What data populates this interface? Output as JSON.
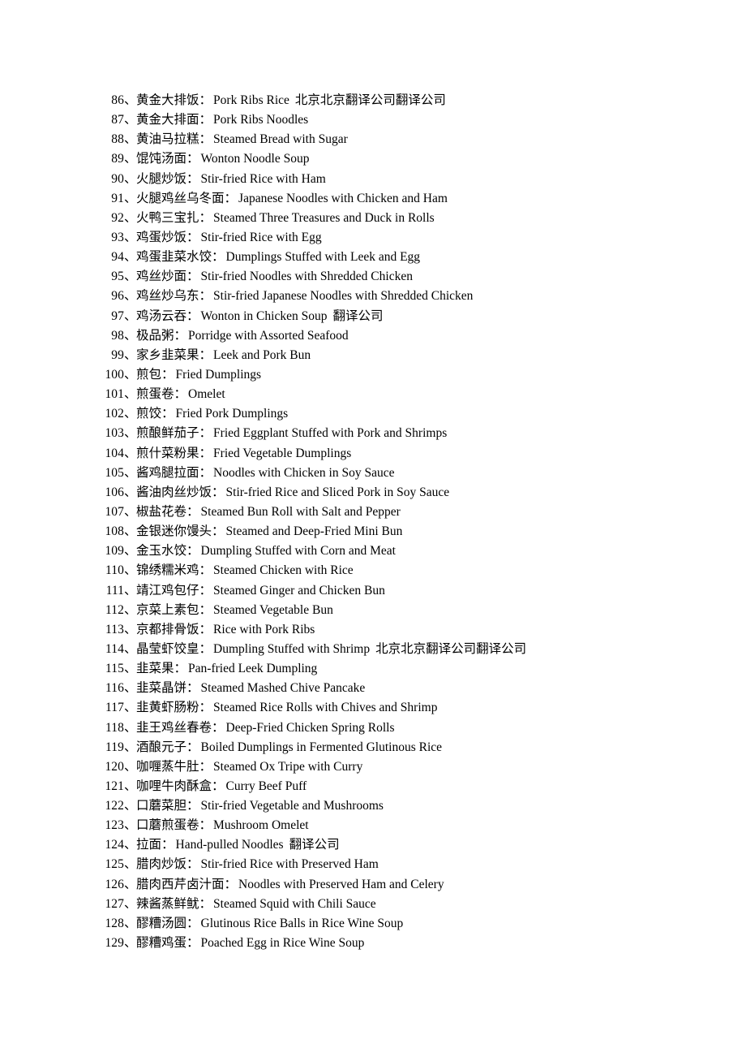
{
  "document": {
    "type": "chinese-english-menu-glossary",
    "page_background": "#ffffff",
    "text_color": "#000000",
    "separator": "、",
    "colon": "：",
    "watermarks": {
      "long": "北京北京翻译公司翻译公司",
      "short": "翻译公司"
    },
    "entries": [
      {
        "num": "86",
        "cn": "黄金大排饭",
        "en": "Pork Ribs Rice",
        "wm": "北京北京翻译公司翻译公司"
      },
      {
        "num": "87",
        "cn": "黄金大排面",
        "en": "Pork Ribs Noodles",
        "wm": ""
      },
      {
        "num": "88",
        "cn": "黄油马拉糕",
        "en": "Steamed Bread with Sugar",
        "wm": ""
      },
      {
        "num": "89",
        "cn": "馄饨汤面",
        "en": "Wonton Noodle Soup",
        "wm": ""
      },
      {
        "num": "90",
        "cn": "火腿炒饭",
        "en": "Stir-fried Rice with Ham",
        "wm": ""
      },
      {
        "num": "91",
        "cn": "火腿鸡丝乌冬面",
        "en": "Japanese Noodles with Chicken and Ham",
        "wm": ""
      },
      {
        "num": "92",
        "cn": "火鸭三宝扎",
        "en": "Steamed Three Treasures and Duck in Rolls",
        "wm": ""
      },
      {
        "num": "93",
        "cn": "鸡蛋炒饭",
        "en": "Stir-fried Rice with Egg",
        "wm": ""
      },
      {
        "num": "94",
        "cn": "鸡蛋韭菜水饺",
        "en": "Dumplings Stuffed with Leek and Egg",
        "wm": ""
      },
      {
        "num": "95",
        "cn": "鸡丝炒面",
        "en": "Stir-fried Noodles with Shredded Chicken",
        "wm": ""
      },
      {
        "num": "96",
        "cn": "鸡丝炒乌东",
        "en": "Stir-fried Japanese Noodles with Shredded Chicken",
        "wm": ""
      },
      {
        "num": "97",
        "cn": "鸡汤云吞",
        "en": "Wonton in Chicken Soup",
        "wm": "翻译公司"
      },
      {
        "num": "98",
        "cn": "极品粥",
        "en": "Porridge with Assorted Seafood",
        "wm": ""
      },
      {
        "num": "99",
        "cn": "家乡韭菜果",
        "en": "Leek and Pork Bun",
        "wm": ""
      },
      {
        "num": "100",
        "cn": "煎包",
        "en": "Fried Dumplings",
        "wm": ""
      },
      {
        "num": "101",
        "cn": "煎蛋卷",
        "en": "Omelet",
        "wm": ""
      },
      {
        "num": "102",
        "cn": "煎饺",
        "en": "Fried Pork Dumplings",
        "wm": ""
      },
      {
        "num": "103",
        "cn": "煎酿鲜茄子",
        "en": "Fried Eggplant Stuffed with Pork and Shrimps",
        "wm": ""
      },
      {
        "num": "104",
        "cn": "煎什菜粉果",
        "en": "Fried Vegetable Dumplings",
        "wm": ""
      },
      {
        "num": "105",
        "cn": "酱鸡腿拉面",
        "en": "Noodles with Chicken in Soy Sauce",
        "wm": ""
      },
      {
        "num": "106",
        "cn": "酱油肉丝炒饭",
        "en": "Stir-fried Rice and Sliced Pork in Soy Sauce",
        "wm": ""
      },
      {
        "num": "107",
        "cn": "椒盐花卷",
        "en": "Steamed Bun Roll with Salt and Pepper",
        "wm": ""
      },
      {
        "num": "108",
        "cn": "金银迷你馒头",
        "en": "Steamed and Deep-Fried Mini Bun",
        "wm": ""
      },
      {
        "num": "109",
        "cn": "金玉水饺",
        "en": "Dumpling Stuffed with Corn and Meat",
        "wm": ""
      },
      {
        "num": "110",
        "cn": "锦绣糯米鸡",
        "en": "Steamed Chicken with Rice",
        "wm": ""
      },
      {
        "num": "111",
        "cn": "靖江鸡包仔",
        "en": "Steamed Ginger and Chicken Bun",
        "wm": ""
      },
      {
        "num": "112",
        "cn": "京菜上素包",
        "en": "Steamed Vegetable Bun",
        "wm": ""
      },
      {
        "num": "113",
        "cn": "京都排骨饭",
        "en": "Rice with Pork Ribs",
        "wm": ""
      },
      {
        "num": "114",
        "cn": "晶莹虾饺皇",
        "en": "Dumpling Stuffed with Shrimp",
        "wm": "北京北京翻译公司翻译公司"
      },
      {
        "num": "115",
        "cn": "韭菜果",
        "en": "Pan-fried Leek Dumpling",
        "wm": ""
      },
      {
        "num": "116",
        "cn": "韭菜晶饼",
        "en": "Steamed Mashed Chive Pancake",
        "wm": ""
      },
      {
        "num": "117",
        "cn": "韭黄虾肠粉",
        "en": "Steamed Rice Rolls with Chives and Shrimp",
        "wm": ""
      },
      {
        "num": "118",
        "cn": "韭王鸡丝春卷",
        "en": "Deep-Fried Chicken Spring Rolls",
        "wm": ""
      },
      {
        "num": "119",
        "cn": "酒酿元子",
        "en": "Boiled Dumplings in Fermented Glutinous Rice",
        "wm": ""
      },
      {
        "num": "120",
        "cn": "咖喱蒸牛肚",
        "en": "Steamed Ox Tripe with Curry",
        "wm": ""
      },
      {
        "num": "121",
        "cn": "咖哩牛肉酥盒",
        "en": "Curry Beef Puff",
        "wm": ""
      },
      {
        "num": "122",
        "cn": "口蘑菜胆",
        "en": "Stir-fried Vegetable and Mushrooms",
        "wm": ""
      },
      {
        "num": "123",
        "cn": "口蘑煎蛋卷",
        "en": "Mushroom Omelet",
        "wm": ""
      },
      {
        "num": "124",
        "cn": "拉面",
        "en": "Hand-pulled Noodles",
        "wm": "翻译公司"
      },
      {
        "num": "125",
        "cn": "腊肉炒饭",
        "en": "Stir-fried Rice with Preserved Ham",
        "wm": ""
      },
      {
        "num": "126",
        "cn": "腊肉西芹卤汁面",
        "en": "Noodles with Preserved Ham and Celery",
        "wm": ""
      },
      {
        "num": "127",
        "cn": "辣酱蒸鲜鱿",
        "en": "Steamed Squid with Chili Sauce",
        "wm": ""
      },
      {
        "num": "128",
        "cn": "醪糟汤圆",
        "en": "Glutinous Rice Balls in Rice Wine Soup",
        "wm": ""
      },
      {
        "num": "129",
        "cn": "醪糟鸡蛋",
        "en": "Poached Egg in Rice Wine Soup",
        "wm": ""
      }
    ]
  }
}
